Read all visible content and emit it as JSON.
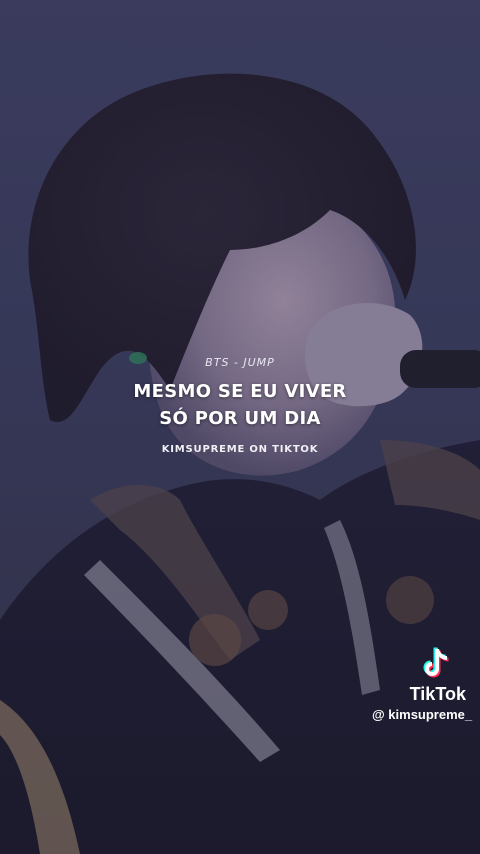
{
  "overlay": {
    "song_label": "BTS - JUMP",
    "lyric_line_1": "MESMO SE EU VIVER",
    "lyric_line_2": "SÓ POR UM DIA",
    "credit": "KIMSUPREME ON TIKTOK"
  },
  "watermark": {
    "brand": "TikTok",
    "handle": "@ kimsupreme_",
    "icon": "tiktok-logo-icon"
  },
  "colors": {
    "background": "#3b3d5c",
    "text": "#ffffff"
  }
}
